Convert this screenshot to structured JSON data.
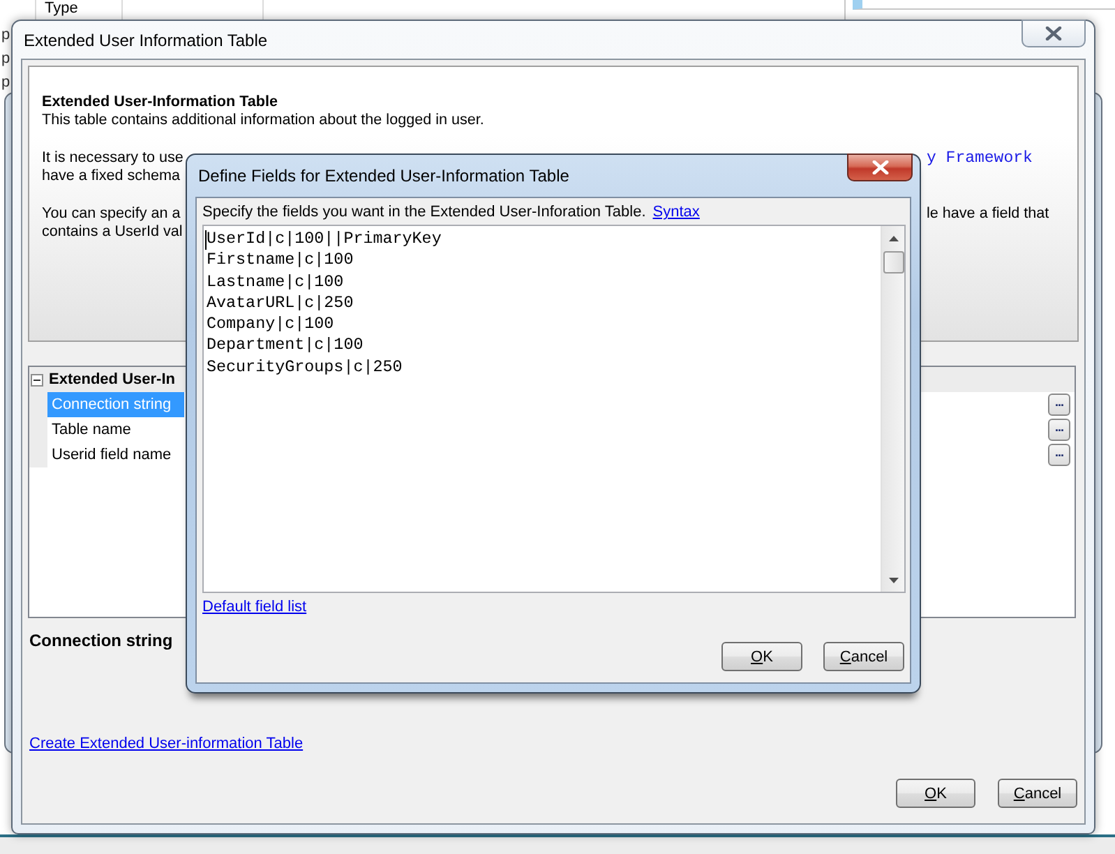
{
  "background_app": {
    "column_header": "Type",
    "row_texts": [
      "p",
      "p",
      "p"
    ]
  },
  "main_window": {
    "title": "Extended User Information Table",
    "info_panel": {
      "heading": "Extended User-Information Table",
      "description": "This table contains additional information about the logged in user.",
      "paragraphs": [
        {
          "lines": [
            {
              "left": "It is necessary to use",
              "right": {
                "kind": "code",
                "text": "y Framework"
              }
            },
            {
              "left": "have a fixed schema"
            }
          ]
        },
        {
          "lines": [
            {
              "left": "You can specify an a",
              "right": {
                "kind": "text",
                "text": "le have a field that"
              }
            },
            {
              "left": "contains a UserId val"
            }
          ]
        }
      ]
    },
    "property_grid": {
      "category": {
        "label": "Extended User-In",
        "expanded": true
      },
      "properties": [
        {
          "name": "Connection string",
          "selected": true,
          "button": "..."
        },
        {
          "name": "Table name",
          "selected": false,
          "button": "..."
        },
        {
          "name": "Userid field name",
          "selected": false,
          "button": "..."
        }
      ]
    },
    "description_title": "Connection string",
    "link": "Create Extended User-information Table",
    "buttons": [
      {
        "label": "OK",
        "mnemonic": true
      },
      {
        "label": "Cancel",
        "mnemonic": true
      }
    ]
  },
  "dialog": {
    "title": "Define Fields for Extended User-Information Table",
    "instruction": "Specify the fields you want in the Extended User-Inforation Table.",
    "syntax_link": "Syntax",
    "field": {
      "focused": true,
      "lines": [
        "UserId|c|100||PrimaryKey",
        "Firstname|c|100",
        "Lastname|c|100",
        "AvatarURL|c|250",
        "Company|c|100",
        "Department|c|100",
        "SecurityGroups|c|250"
      ]
    },
    "default_link": "Default field list",
    "buttons": [
      {
        "label": "OK",
        "mnemonic": true
      },
      {
        "label": "Cancel",
        "mnemonic": true
      }
    ]
  }
}
